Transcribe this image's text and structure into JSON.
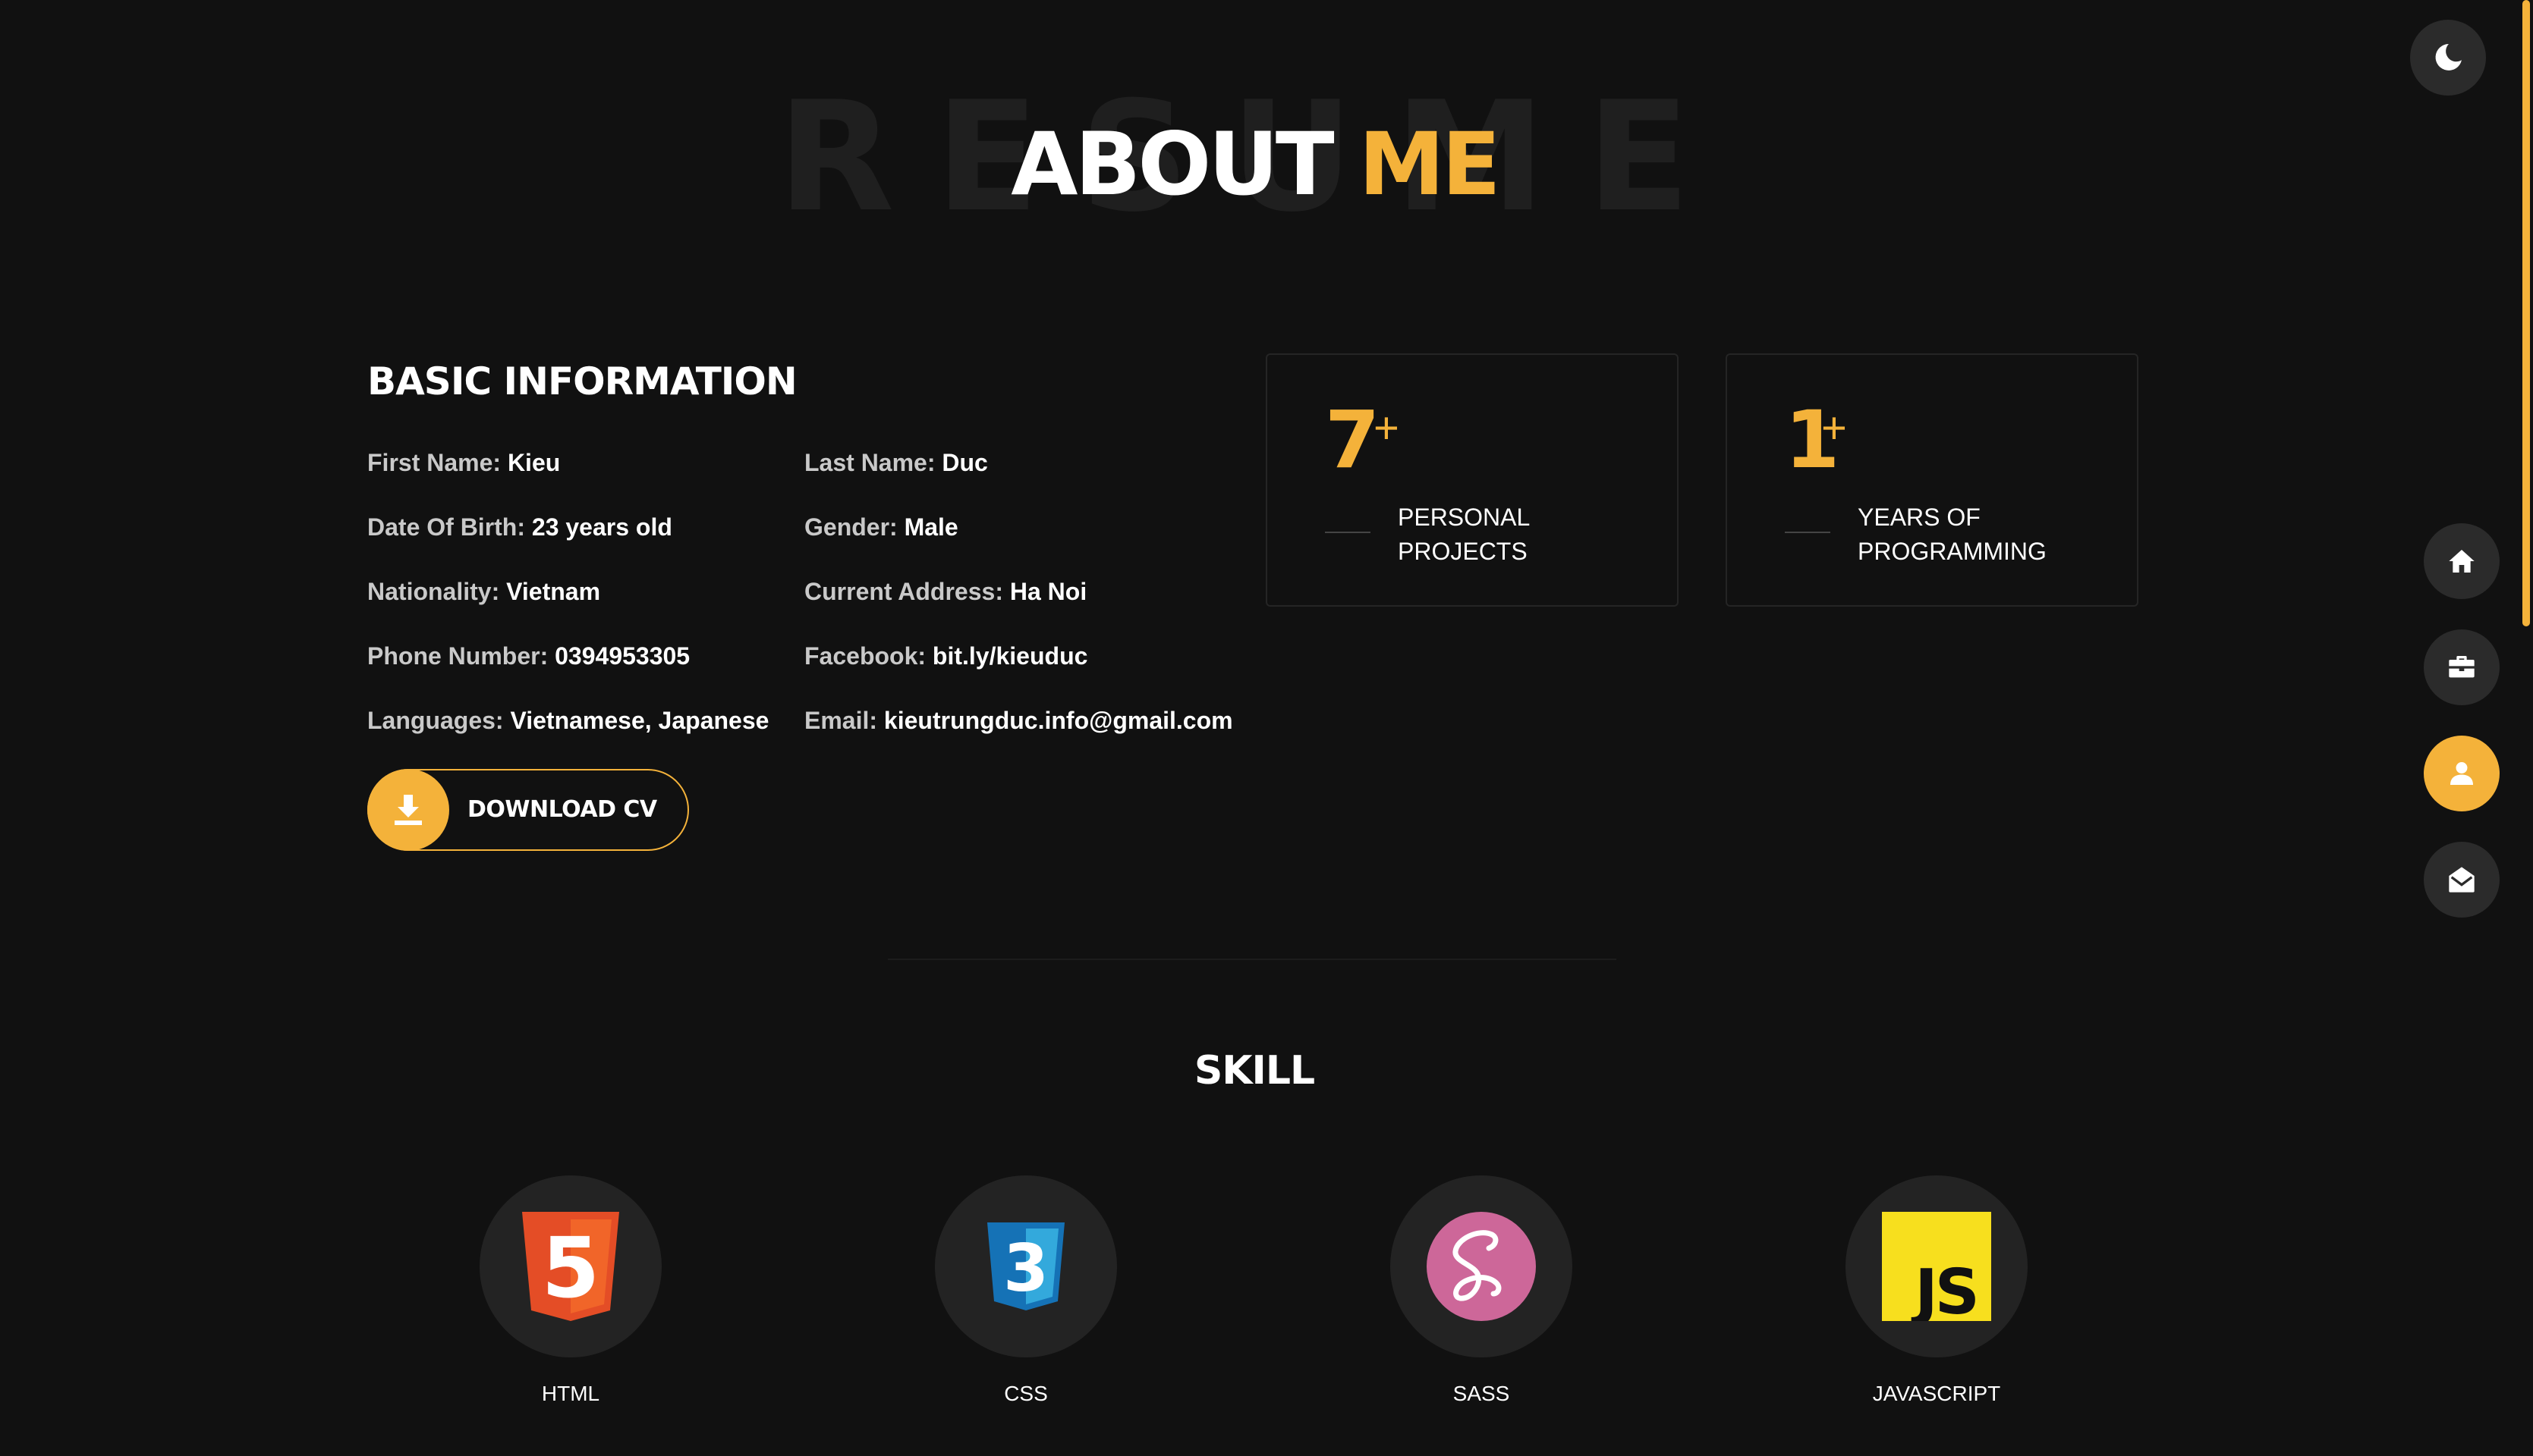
{
  "heading": {
    "background_word": "RESUME",
    "title_main": "ABOUT",
    "title_accent": "ME"
  },
  "basic_info": {
    "title": "BASIC INFORMATION",
    "rows": [
      {
        "label": "First Name:",
        "value": "Kieu"
      },
      {
        "label": "Last Name:",
        "value": "Duc"
      },
      {
        "label": "Date Of Birth:",
        "value": "23 years old"
      },
      {
        "label": "Gender:",
        "value": "Male"
      },
      {
        "label": "Nationality:",
        "value": "Vietnam"
      },
      {
        "label": "Current Address:",
        "value": "Ha Noi"
      },
      {
        "label": "Phone Number:",
        "value": "0394953305"
      },
      {
        "label": "Facebook:",
        "value": "bit.ly/kieuduc"
      },
      {
        "label": "Languages:",
        "value": "Vietnamese, Japanese"
      },
      {
        "label": "Email:",
        "value": "kieutrungduc.info@gmail.com"
      }
    ],
    "download_label": "DOWNLOAD CV"
  },
  "stats": [
    {
      "number": "7",
      "plus": "+",
      "label_line1": "PERSONAL",
      "label_line2": "PROJECTS"
    },
    {
      "number": "1",
      "plus": "+",
      "label_line1": "YEARS OF",
      "label_line2": "PROGRAMMING"
    }
  ],
  "skills": {
    "title": "SKILL",
    "items": [
      {
        "label": "HTML",
        "icon": "html5-icon",
        "badge_text": "5",
        "color": "#e44d26"
      },
      {
        "label": "CSS",
        "icon": "css3-icon",
        "badge_text": "3",
        "color": "#1572b6"
      },
      {
        "label": "SASS",
        "icon": "sass-icon",
        "color": "#cd6799"
      },
      {
        "label": "JAVASCRIPT",
        "icon": "javascript-icon",
        "badge_text": "JS",
        "color": "#f7df1e"
      }
    ]
  },
  "side_nav": {
    "items": [
      {
        "name": "home",
        "icon": "home-icon"
      },
      {
        "name": "portfolio",
        "icon": "briefcase-icon"
      },
      {
        "name": "about",
        "icon": "user-icon",
        "active": true
      },
      {
        "name": "contact",
        "icon": "envelope-open-icon"
      }
    ]
  },
  "theme_toggle": {
    "icon": "moon-icon"
  },
  "colors": {
    "accent": "#f4b23a",
    "background": "#111111",
    "card_border": "#252525"
  }
}
